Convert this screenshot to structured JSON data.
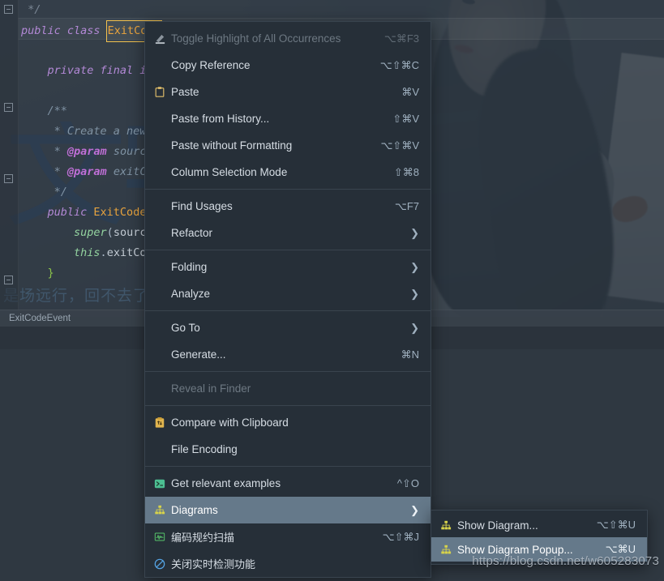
{
  "editor": {
    "code_lines": [
      " */",
      "public class ExitCode",
      "",
      "    private final int",
      "",
      "    /**",
      "     * Create a new {",
      "     * @param source",
      "     * @param exitCod",
      "     */",
      "    public ExitCodeEv",
      "        super(source)",
      "        this.exitCode",
      "    }"
    ],
    "selected_token": "ExitCode",
    "breadcrumb": "ExitCodeEvent",
    "background_text_sub": "是场远行，回不去了"
  },
  "context_menu": {
    "items": [
      {
        "label": "Toggle Highlight of All Occurrences",
        "shortcut": "⌥⌘F3",
        "icon": "highlighter-icon",
        "disabled": true,
        "submenu": false,
        "selected": false
      },
      {
        "label": "Copy Reference",
        "shortcut": "⌥⇧⌘C",
        "icon": "",
        "disabled": false,
        "submenu": false,
        "selected": false
      },
      {
        "label": "Paste",
        "shortcut": "⌘V",
        "icon": "clipboard-icon",
        "disabled": false,
        "submenu": false,
        "selected": false
      },
      {
        "label": "Paste from History...",
        "shortcut": "⇧⌘V",
        "icon": "",
        "disabled": false,
        "submenu": false,
        "selected": false
      },
      {
        "label": "Paste without Formatting",
        "shortcut": "⌥⇧⌘V",
        "icon": "",
        "disabled": false,
        "submenu": false,
        "selected": false
      },
      {
        "label": "Column Selection Mode",
        "shortcut": "⇧⌘8",
        "icon": "",
        "disabled": false,
        "submenu": false,
        "selected": false
      },
      {
        "separator": true
      },
      {
        "label": "Find Usages",
        "shortcut": "⌥F7",
        "icon": "",
        "disabled": false,
        "submenu": false,
        "selected": false
      },
      {
        "label": "Refactor",
        "shortcut": "",
        "icon": "",
        "disabled": false,
        "submenu": true,
        "selected": false
      },
      {
        "separator": true
      },
      {
        "label": "Folding",
        "shortcut": "",
        "icon": "",
        "disabled": false,
        "submenu": true,
        "selected": false
      },
      {
        "label": "Analyze",
        "shortcut": "",
        "icon": "",
        "disabled": false,
        "submenu": true,
        "selected": false
      },
      {
        "separator": true
      },
      {
        "label": "Go To",
        "shortcut": "",
        "icon": "",
        "disabled": false,
        "submenu": true,
        "selected": false
      },
      {
        "label": "Generate...",
        "shortcut": "⌘N",
        "icon": "",
        "disabled": false,
        "submenu": false,
        "selected": false
      },
      {
        "separator": true
      },
      {
        "label": "Reveal in Finder",
        "shortcut": "",
        "icon": "",
        "disabled": true,
        "submenu": false,
        "selected": false
      },
      {
        "separator": true
      },
      {
        "label": "Compare with Clipboard",
        "shortcut": "",
        "icon": "compare-clipboard-icon",
        "disabled": false,
        "submenu": false,
        "selected": false
      },
      {
        "label": "File Encoding",
        "shortcut": "",
        "icon": "",
        "disabled": false,
        "submenu": false,
        "selected": false
      },
      {
        "separator": true
      },
      {
        "label": "Get relevant examples",
        "shortcut": "^⇧O",
        "icon": "terminal-icon",
        "disabled": false,
        "submenu": false,
        "selected": false
      },
      {
        "label": "Diagrams",
        "shortcut": "",
        "icon": "diagram-icon",
        "disabled": false,
        "submenu": true,
        "selected": true
      },
      {
        "label": "编码规约扫描",
        "shortcut": "⌥⇧⌘J",
        "icon": "waveform-icon",
        "disabled": false,
        "submenu": false,
        "selected": false,
        "cjk": true
      },
      {
        "label": "关闭实时检测功能",
        "shortcut": "",
        "icon": "circle-slash-icon",
        "disabled": false,
        "submenu": false,
        "selected": false,
        "cjk": true
      }
    ]
  },
  "submenu": {
    "items": [
      {
        "label": "Show Diagram...",
        "shortcut": "⌥⇧⌘U",
        "icon": "diagram-icon",
        "selected": false
      },
      {
        "label": "Show Diagram Popup...",
        "shortcut": "⌥⌘U",
        "icon": "diagram-icon",
        "selected": true
      }
    ]
  },
  "watermark": {
    "url": "https://blog.csdn.net/w605283073"
  },
  "colors": {
    "menu_bg": "#262f38",
    "menu_selection": "#65798a",
    "editor_bg": "#2f3640",
    "accent_yellow": "#d6d34a",
    "accent_green": "#4caf82"
  }
}
